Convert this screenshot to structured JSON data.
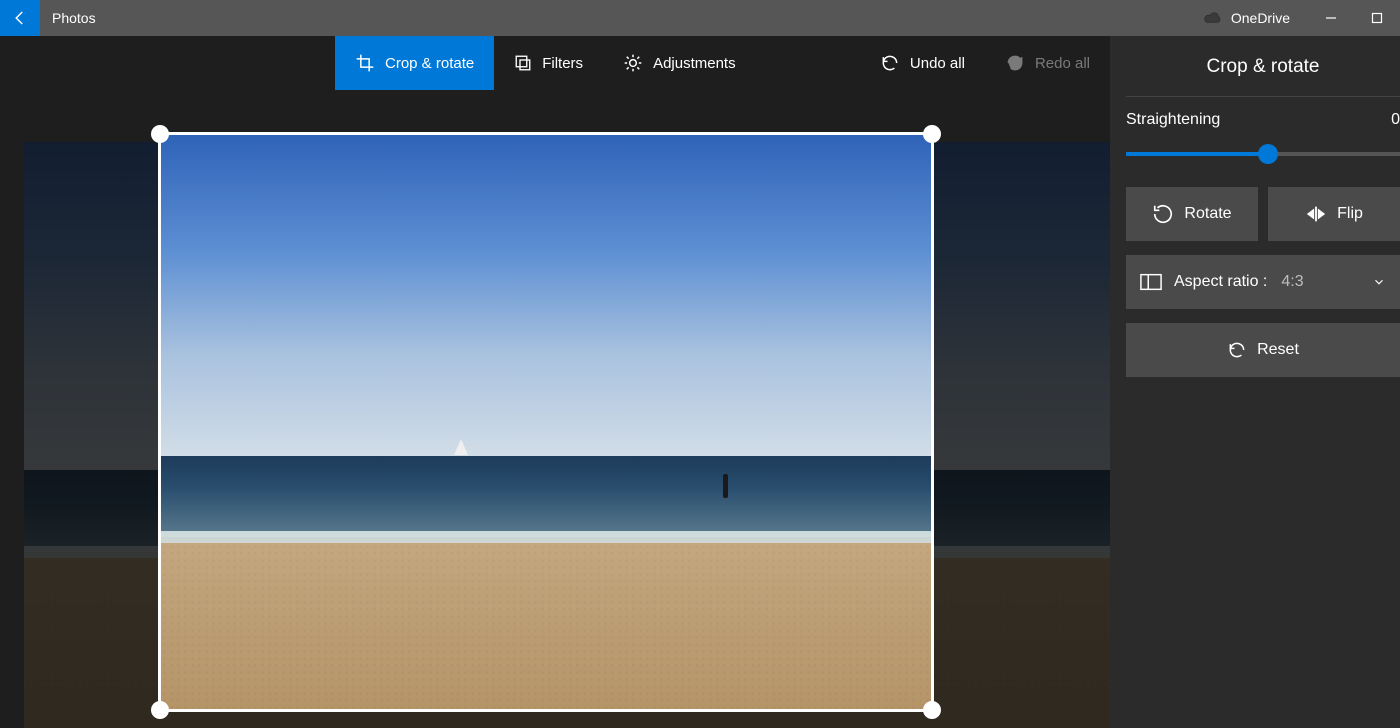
{
  "titlebar": {
    "app_name": "Photos",
    "cloud_label": "OneDrive"
  },
  "toolbar": {
    "crop_label": "Crop & rotate",
    "filters_label": "Filters",
    "adjustments_label": "Adjustments",
    "undo_label": "Undo all",
    "redo_label": "Redo all"
  },
  "sidebar": {
    "title": "Crop & rotate",
    "straightening_label": "Straightening",
    "straightening_value": "0",
    "rotate_label": "Rotate",
    "flip_label": "Flip",
    "aspect_label": "Aspect ratio :",
    "aspect_value": "4:3",
    "reset_label": "Reset"
  }
}
